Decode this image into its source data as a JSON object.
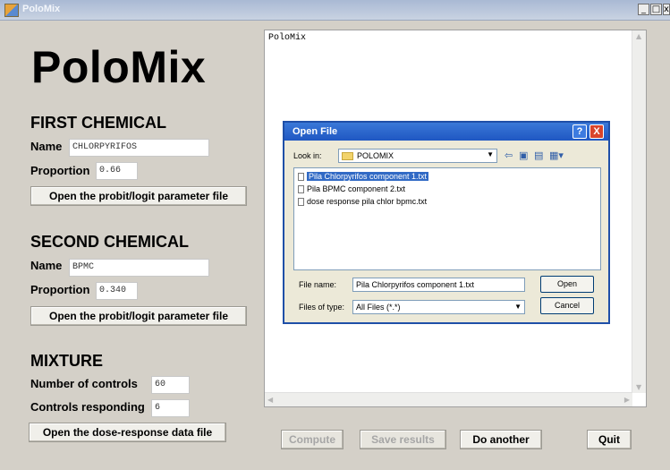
{
  "window": {
    "title": "PoloMix",
    "controls": [
      "_",
      "□",
      "x"
    ]
  },
  "brand": "PoloMix",
  "first": {
    "heading": "FIRST CHEMICAL",
    "name_label": "Name",
    "name_value": "CHLORPYRIFOS",
    "proportion_label": "Proportion",
    "proportion_value": "0.66",
    "open_button": "Open the probit/logit parameter file"
  },
  "second": {
    "heading": "SECOND CHEMICAL",
    "name_label": "Name",
    "name_value": "BPMC",
    "proportion_label": "Proportion",
    "proportion_value": "0.340",
    "open_button": "Open the probit/logit parameter file"
  },
  "mixture": {
    "heading": "MIXTURE",
    "controls_label": "Number of controls",
    "controls_value": "60",
    "responding_label": "Controls responding",
    "responding_value": "6",
    "open_button": "Open the dose-response data file"
  },
  "output": {
    "text": "PoloMix"
  },
  "actions": {
    "compute": "Compute",
    "save": "Save results",
    "another": "Do another",
    "quit": "Quit"
  },
  "dialog": {
    "title": "Open File",
    "help": "?",
    "close": "X",
    "look_in_label": "Look in:",
    "look_in_value": "POLOMIX",
    "files": [
      "Pila Chlorpyrifos component 1.txt",
      "Pila BPMC component 2.txt",
      "dose response pila chlor bpmc.txt"
    ],
    "selected_index": 0,
    "file_name_label": "File name:",
    "file_name_value": "Pila Chlorpyrifos component 1.txt",
    "files_of_type_label": "Files of type:",
    "files_of_type_value": "All Files (*.*)",
    "open_button": "Open",
    "cancel_button": "Cancel"
  },
  "icons": {
    "app": "app-icon",
    "folder": "folder-icon",
    "back": "back-arrow-icon",
    "up": "up-folder-icon",
    "new_folder": "new-folder-icon",
    "view": "view-menu-icon"
  },
  "colors": {
    "selection": "#316ac5",
    "dialog_title": "#2a66cc",
    "close": "#d9442b",
    "window_bg": "#d4d0c8"
  }
}
